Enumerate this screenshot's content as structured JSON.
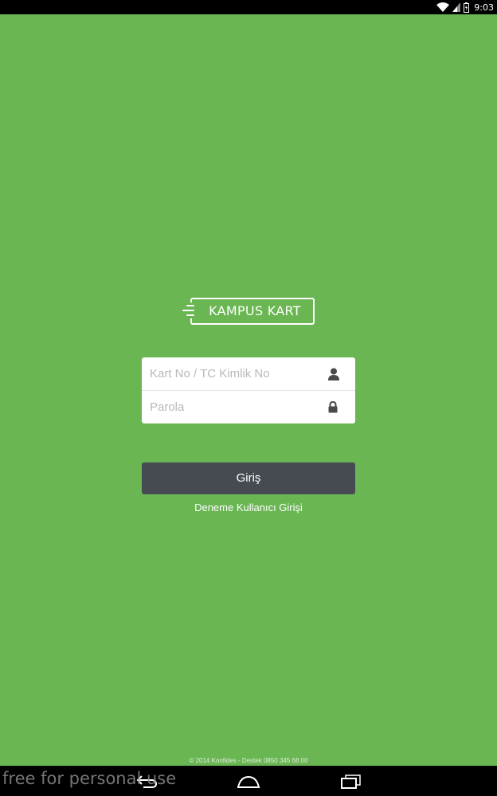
{
  "status_bar": {
    "time": "9:03",
    "icons": [
      "wifi-icon",
      "signal-icon",
      "battery-charging-icon"
    ]
  },
  "logo": {
    "text": "KAMPUS KART"
  },
  "login_form": {
    "card_number_placeholder": "Kart No / TC Kimlik No",
    "card_number_value": "",
    "password_placeholder": "Parola",
    "password_value": "",
    "card_number_icon": "user-icon",
    "password_icon": "lock-icon"
  },
  "login_button": {
    "label": "Giriş"
  },
  "demo_link": {
    "label": "Deneme Kullanıcı Girişi"
  },
  "footer": {
    "text": "© 2014 Konfides - Destek 0850 345 68 00"
  },
  "watermark": {
    "text": "free for personal use"
  },
  "nav_bar": {
    "buttons": [
      "back-icon",
      "home-icon",
      "recent-apps-icon"
    ]
  },
  "colors": {
    "background": "#69b653",
    "button": "#464b52",
    "status_bar": "#000000"
  }
}
